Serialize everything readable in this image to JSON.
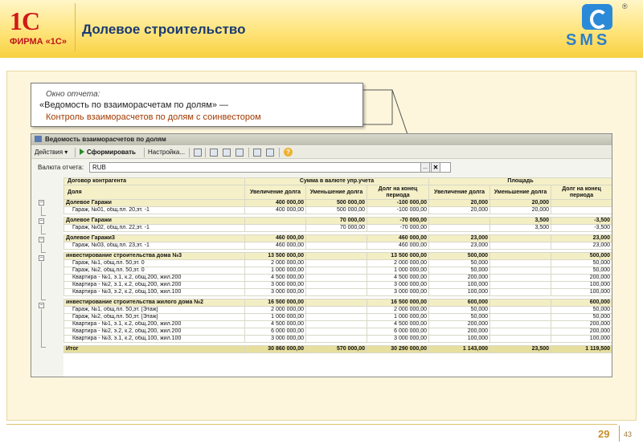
{
  "slide": {
    "logo_mark": "1С",
    "logo_firm": "ФИРМА «1С»",
    "title": "Долевое строительство",
    "brand_logo": "SMS",
    "brand_reg": "®",
    "page_number": "29",
    "page_total": "43"
  },
  "callout": {
    "line1": "Окно отчета:",
    "line2": "«Ведомость по взаиморасчетам по долям» —",
    "line3": "Контроль взаиморасчетов по долям с соинвестором"
  },
  "window": {
    "title": "Ведомость взаиморасчетов по долям",
    "toolbar": {
      "actions": "Действия ▾",
      "generate": "Сформировать",
      "settings": "Настройка..."
    },
    "currency_label": "Валюта отчета:",
    "currency_value": "RUB",
    "dots": "...",
    "clear": "✕"
  },
  "table": {
    "headers": {
      "contract": "Договор контрагента",
      "share": "Доля",
      "sum_group": "Сумма в валюте упр.учета",
      "area_group": "Площадь",
      "increase": "Увеличение долга",
      "decrease": "Уменьшение долга",
      "debt_end": "Долг на конец периода"
    },
    "rows": [
      {
        "type": "group",
        "name": "Долевое Гаражи",
        "c": [
          "400 000,00",
          "500 000,00",
          "-100 000,00",
          "20,000",
          "20,000",
          ""
        ]
      },
      {
        "type": "item",
        "name": "Гараж, №01, общ.пл. 20,эт. -1",
        "c": [
          "400 000,00",
          "500 000,00",
          "-100 000,00",
          "20,000",
          "20,000",
          ""
        ]
      },
      {
        "type": "gap"
      },
      {
        "type": "group",
        "name": "Долевое Гаражи",
        "c": [
          "",
          "70 000,00",
          "-70 000,00",
          "",
          "3,500",
          "-3,500"
        ]
      },
      {
        "type": "item",
        "name": "Гараж, №02, общ.пл. 22,эт. -1",
        "c": [
          "",
          "70 000,00",
          "-70 000,00",
          "",
          "3,500",
          "-3,500"
        ]
      },
      {
        "type": "gap"
      },
      {
        "type": "group",
        "name": "Долевое Гаражи3",
        "c": [
          "460 000,00",
          "",
          "460 000,00",
          "23,000",
          "",
          "23,000"
        ]
      },
      {
        "type": "item",
        "name": "Гараж, №03, общ.пл. 23,эт. -1",
        "c": [
          "460 000,00",
          "",
          "460 000,00",
          "23,000",
          "",
          "23,000"
        ]
      },
      {
        "type": "gap"
      },
      {
        "type": "group",
        "name": "инвестирование строительства дома №3",
        "c": [
          "13 500 000,00",
          "",
          "13 500 000,00",
          "500,000",
          "",
          "500,000"
        ]
      },
      {
        "type": "item",
        "name": "Гараж, №1, общ.пл. 50,эт. 0",
        "c": [
          "2 000 000,00",
          "",
          "2 000 000,00",
          "50,000",
          "",
          "50,000"
        ]
      },
      {
        "type": "item",
        "name": "Гараж, №2, общ.пл. 50,эт. 0",
        "c": [
          "1 000 000,00",
          "",
          "1 000 000,00",
          "50,000",
          "",
          "50,000"
        ]
      },
      {
        "type": "item",
        "name": "Квартира - №1,  э.1, к.2, общ.200, жил.200",
        "c": [
          "4 500 000,00",
          "",
          "4 500 000,00",
          "200,000",
          "",
          "200,000"
        ]
      },
      {
        "type": "item",
        "name": "Квартира - №2,  э.1, к.2, общ.200, жил.200",
        "c": [
          "3 000 000,00",
          "",
          "3 000 000,00",
          "100,000",
          "",
          "100,000"
        ]
      },
      {
        "type": "item",
        "name": "Квартира - №3,  э.2, к.2, общ.100, жил.100",
        "c": [
          "3 000 000,00",
          "",
          "3 000 000,00",
          "100,000",
          "",
          "100,000"
        ]
      },
      {
        "type": "gap"
      },
      {
        "type": "group",
        "name": "инвестирование строительства жилого дома №2",
        "c": [
          "16 500 000,00",
          "",
          "16 500 000,00",
          "600,000",
          "",
          "600,000"
        ]
      },
      {
        "type": "item",
        "name": "Гараж, №1, общ.пл. 50,эт. [Этаж]",
        "c": [
          "2 000 000,00",
          "",
          "2 000 000,00",
          "50,000",
          "",
          "50,000"
        ]
      },
      {
        "type": "item",
        "name": "Гараж, №2, общ.пл. 50,эт. [Этаж]",
        "c": [
          "1 000 000,00",
          "",
          "1 000 000,00",
          "50,000",
          "",
          "50,000"
        ]
      },
      {
        "type": "item",
        "name": "Квартира - №1,  э.1, к.2, общ.200, жил.200",
        "c": [
          "4 500 000,00",
          "",
          "4 500 000,00",
          "200,000",
          "",
          "200,000"
        ]
      },
      {
        "type": "item",
        "name": "Квартира - №2,  э.2, к.2, общ.200, жил.200",
        "c": [
          "6 000 000,00",
          "",
          "6 000 000,00",
          "200,000",
          "",
          "200,000"
        ]
      },
      {
        "type": "item",
        "name": "Квартира - №3,  э.1, к.2, общ.100, жил.100",
        "c": [
          "3 000 000,00",
          "",
          "3 000 000,00",
          "100,000",
          "",
          "100,000"
        ]
      },
      {
        "type": "gap"
      },
      {
        "type": "total",
        "name": "Итог",
        "c": [
          "30 860 000,00",
          "570 000,00",
          "30 290 000,00",
          "1 143,000",
          "23,500",
          "1 119,500"
        ]
      }
    ]
  }
}
